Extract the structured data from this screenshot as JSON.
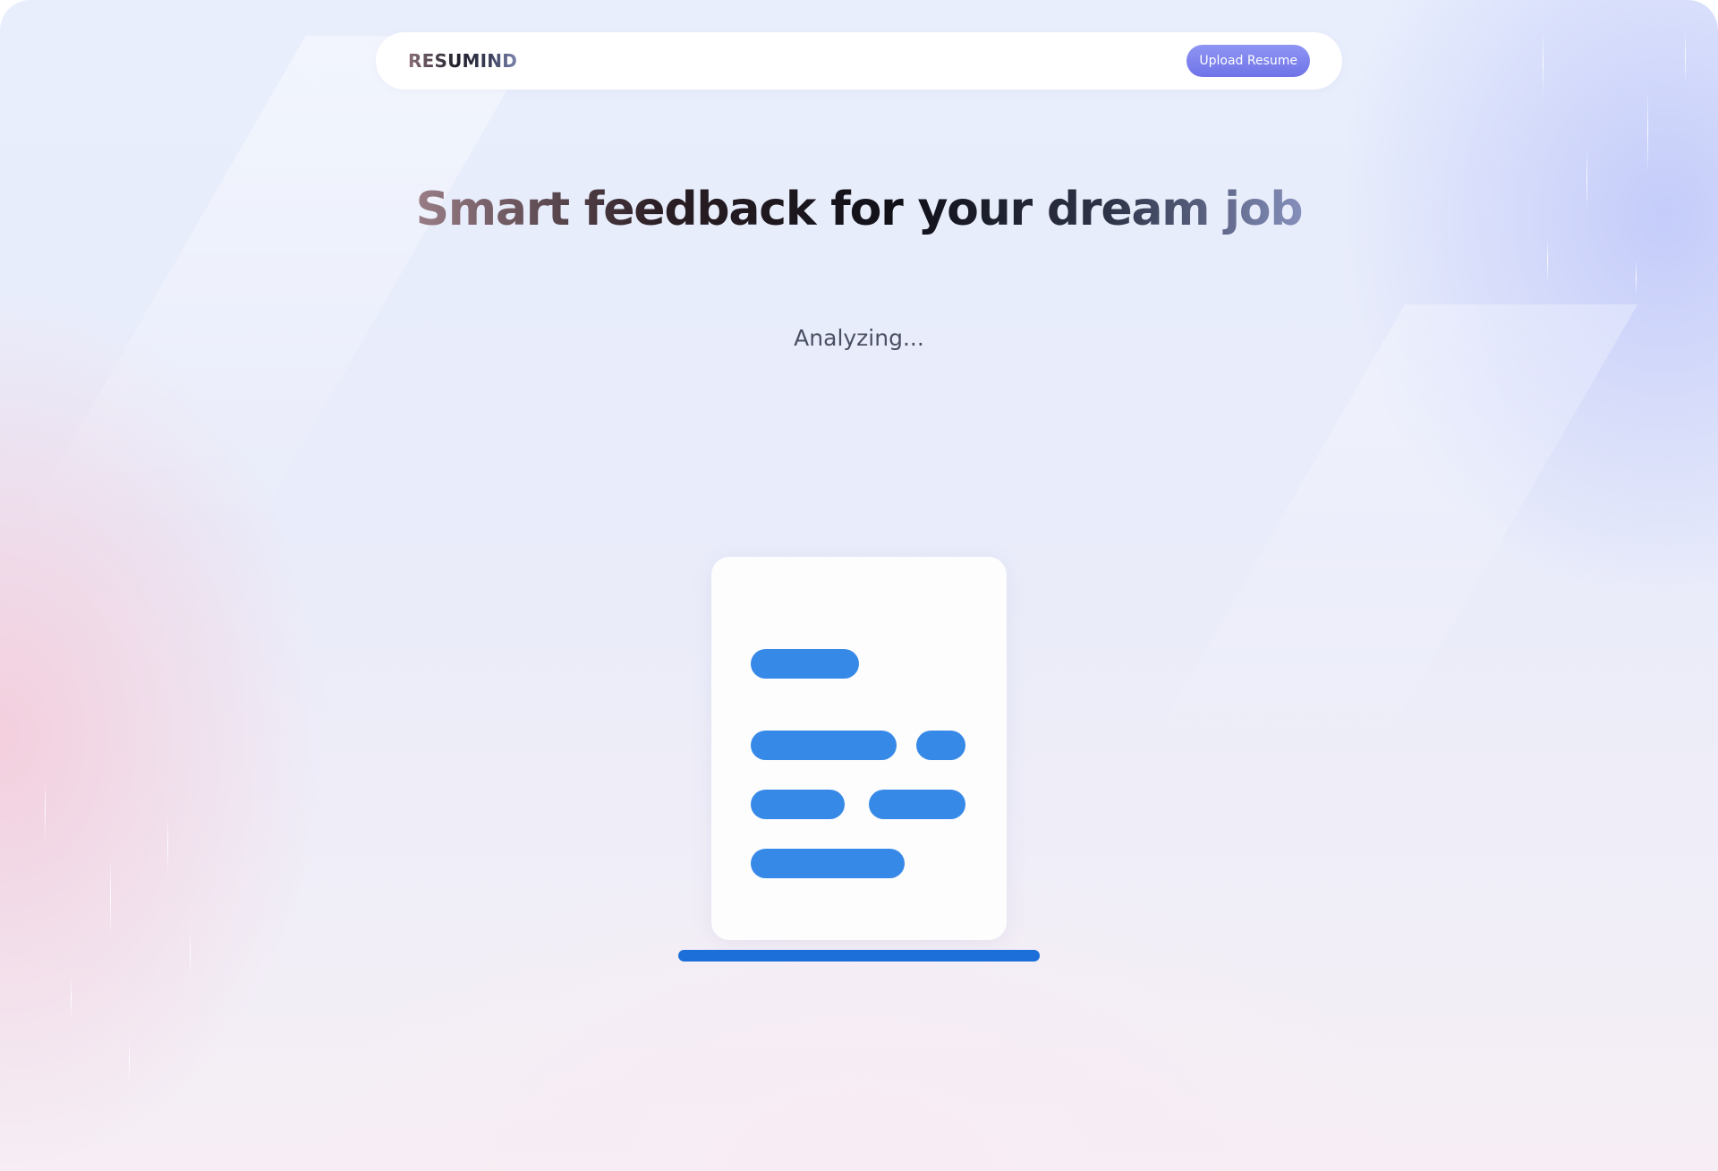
{
  "navbar": {
    "logo": "RESUMIND",
    "upload_label": "Upload Resume"
  },
  "hero": {
    "headline": "Smart feedback for your dream job",
    "status": "Analyzing..."
  },
  "colors": {
    "accent": "#6f73e8",
    "skeleton_bar": "#3789e8",
    "scan_line": "#1c6fd9"
  },
  "icons": {
    "document": "document-icon"
  }
}
